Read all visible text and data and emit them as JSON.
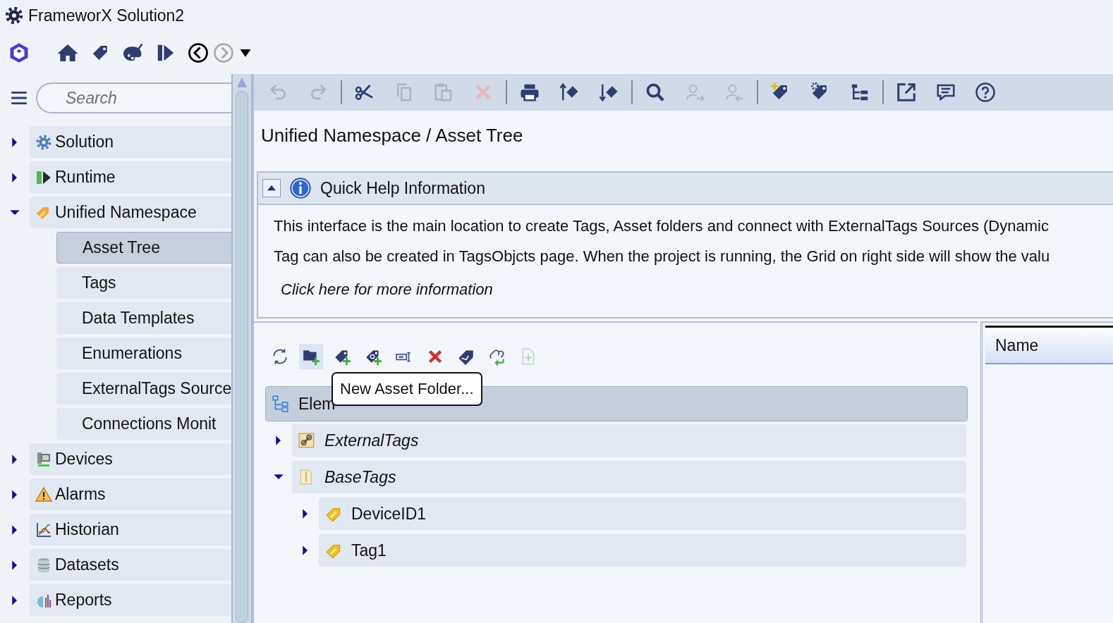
{
  "window": {
    "title": "FrameworX Solution2"
  },
  "nav_buttons": [
    {
      "disabled": false
    },
    {
      "disabled": true
    }
  ],
  "sidebar": {
    "search": {
      "placeholder": "Search"
    },
    "items": [
      {
        "label": "Solution",
        "expanded": false
      },
      {
        "label": "Runtime",
        "expanded": false
      },
      {
        "label": "Unified Namespace",
        "expanded": true,
        "children": [
          {
            "label": "Asset Tree",
            "selected": true
          },
          {
            "label": "Tags",
            "selected": false
          },
          {
            "label": "Data Templates",
            "selected": false
          },
          {
            "label": "Enumerations",
            "selected": false
          },
          {
            "label": "ExternalTags Source",
            "selected": false
          },
          {
            "label": "Connections Monit",
            "selected": false
          }
        ]
      },
      {
        "label": "Devices",
        "expanded": false
      },
      {
        "label": "Alarms",
        "expanded": false
      },
      {
        "label": "Historian",
        "expanded": false
      },
      {
        "label": "Datasets",
        "expanded": false
      },
      {
        "label": "Reports",
        "expanded": false
      }
    ]
  },
  "main_toolbar": [
    {
      "disabled": true
    },
    {
      "disabled": true
    },
    {
      "disabled": false
    },
    {
      "disabled": true
    },
    {
      "disabled": true
    },
    {
      "disabled": true
    },
    {
      "disabled": false
    },
    {
      "disabled": false
    },
    {
      "disabled": false
    },
    {
      "disabled": false
    },
    {
      "disabled": true
    },
    {
      "disabled": true
    },
    {
      "disabled": false
    },
    {
      "disabled": false
    },
    {
      "disabled": false
    },
    {
      "disabled": false
    },
    {
      "disabled": false
    },
    {
      "disabled": false
    }
  ],
  "breadcrumb": "Unified Namespace / Asset Tree",
  "quick_help": {
    "title": "Quick Help Information",
    "expanded": true,
    "lines": [
      "This interface is the main location to create Tags, Asset folders and connect with ExternalTags Sources (Dynamic",
      "Tag can also be created in TagsObjcts page. When the project is running, the Grid on right side will show the valu"
    ],
    "link": "Click here for more information"
  },
  "asset_toolbar": [
    {
      "disabled": false,
      "hovered": false
    },
    {
      "disabled": false,
      "hovered": true
    },
    {
      "disabled": false,
      "hovered": false
    },
    {
      "disabled": false,
      "hovered": false
    },
    {
      "disabled": false,
      "hovered": false
    },
    {
      "disabled": false,
      "hovered": false
    },
    {
      "disabled": false,
      "hovered": false
    },
    {
      "disabled": false,
      "hovered": false
    },
    {
      "disabled": true,
      "hovered": false
    }
  ],
  "tooltip": "New Asset Folder...",
  "asset_tree": {
    "label": "Elem",
    "kind": "root",
    "selected": true,
    "children": [
      {
        "label": "ExternalTags",
        "kind": "link-folder",
        "selected": false,
        "expanded": false
      },
      {
        "label": "BaseTags",
        "kind": "folder",
        "selected": false,
        "expanded": true,
        "children": [
          {
            "label": "DeviceID1",
            "kind": "tag",
            "selected": false,
            "expanded": false
          },
          {
            "label": "Tag1",
            "kind": "tag",
            "selected": false,
            "expanded": false
          }
        ]
      }
    ]
  },
  "grid": {
    "columns": [
      "Name"
    ]
  }
}
